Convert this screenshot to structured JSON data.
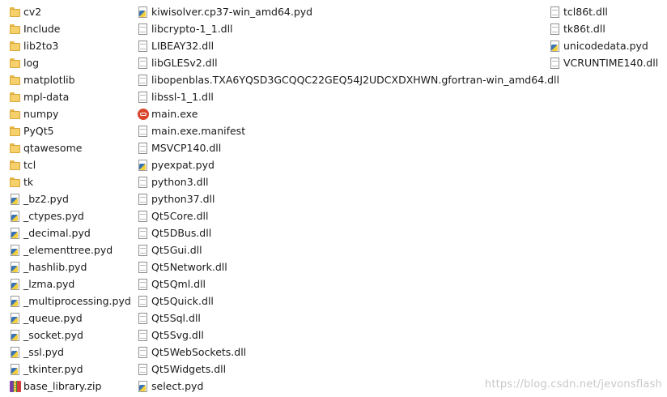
{
  "columns": [
    {
      "items": [
        {
          "name": "cv2",
          "icon": "folder-icon"
        },
        {
          "name": "Include",
          "icon": "folder-icon"
        },
        {
          "name": "lib2to3",
          "icon": "folder-icon"
        },
        {
          "name": "log",
          "icon": "folder-icon"
        },
        {
          "name": "matplotlib",
          "icon": "folder-icon"
        },
        {
          "name": "mpl-data",
          "icon": "folder-icon"
        },
        {
          "name": "numpy",
          "icon": "folder-icon"
        },
        {
          "name": "PyQt5",
          "icon": "folder-icon"
        },
        {
          "name": "qtawesome",
          "icon": "folder-icon"
        },
        {
          "name": "tcl",
          "icon": "folder-icon"
        },
        {
          "name": "tk",
          "icon": "folder-icon"
        },
        {
          "name": "_bz2.pyd",
          "icon": "python-file-icon"
        },
        {
          "name": "_ctypes.pyd",
          "icon": "python-file-icon"
        },
        {
          "name": "_decimal.pyd",
          "icon": "python-file-icon"
        },
        {
          "name": "_elementtree.pyd",
          "icon": "python-file-icon"
        },
        {
          "name": "_hashlib.pyd",
          "icon": "python-file-icon"
        },
        {
          "name": "_lzma.pyd",
          "icon": "python-file-icon"
        },
        {
          "name": "_multiprocessing.pyd",
          "icon": "python-file-icon"
        },
        {
          "name": "_queue.pyd",
          "icon": "python-file-icon"
        },
        {
          "name": "_socket.pyd",
          "icon": "python-file-icon"
        },
        {
          "name": "_ssl.pyd",
          "icon": "python-file-icon"
        },
        {
          "name": "_tkinter.pyd",
          "icon": "python-file-icon"
        },
        {
          "name": "base_library.zip",
          "icon": "zip-archive-icon"
        }
      ]
    },
    {
      "items": [
        {
          "name": "kiwisolver.cp37-win_amd64.pyd",
          "icon": "python-file-icon"
        },
        {
          "name": "libcrypto-1_1.dll",
          "icon": "file-icon"
        },
        {
          "name": "LIBEAY32.dll",
          "icon": "file-icon"
        },
        {
          "name": "libGLESv2.dll",
          "icon": "file-icon"
        },
        {
          "name": "libopenblas.TXA6YQSD3GCQQC22GEQ54J2UDCXDXHWN.gfortran-win_amd64.dll",
          "icon": "file-icon"
        },
        {
          "name": "libssl-1_1.dll",
          "icon": "file-icon"
        },
        {
          "name": "main.exe",
          "icon": "exe-icon"
        },
        {
          "name": "main.exe.manifest",
          "icon": "file-icon"
        },
        {
          "name": "MSVCP140.dll",
          "icon": "file-icon"
        },
        {
          "name": "pyexpat.pyd",
          "icon": "python-file-icon"
        },
        {
          "name": "python3.dll",
          "icon": "file-icon"
        },
        {
          "name": "python37.dll",
          "icon": "file-icon"
        },
        {
          "name": "Qt5Core.dll",
          "icon": "file-icon"
        },
        {
          "name": "Qt5DBus.dll",
          "icon": "file-icon"
        },
        {
          "name": "Qt5Gui.dll",
          "icon": "file-icon"
        },
        {
          "name": "Qt5Network.dll",
          "icon": "file-icon"
        },
        {
          "name": "Qt5Qml.dll",
          "icon": "file-icon"
        },
        {
          "name": "Qt5Quick.dll",
          "icon": "file-icon"
        },
        {
          "name": "Qt5Sql.dll",
          "icon": "file-icon"
        },
        {
          "name": "Qt5Svg.dll",
          "icon": "file-icon"
        },
        {
          "name": "Qt5WebSockets.dll",
          "icon": "file-icon"
        },
        {
          "name": "Qt5Widgets.dll",
          "icon": "file-icon"
        },
        {
          "name": "select.pyd",
          "icon": "python-file-icon"
        }
      ]
    },
    {
      "items": [
        {
          "name": "tcl86t.dll",
          "icon": "file-icon"
        },
        {
          "name": "tk86t.dll",
          "icon": "file-icon"
        },
        {
          "name": "unicodedata.pyd",
          "icon": "python-file-icon"
        },
        {
          "name": "VCRUNTIME140.dll",
          "icon": "file-icon"
        }
      ]
    }
  ],
  "watermark": "https://blog.csdn.net/jevonsflash",
  "colors": {
    "folder": "#f6d16b",
    "python_blue": "#3b74b5",
    "python_yellow": "#f2cf3b",
    "exe_red": "#d9442b"
  }
}
